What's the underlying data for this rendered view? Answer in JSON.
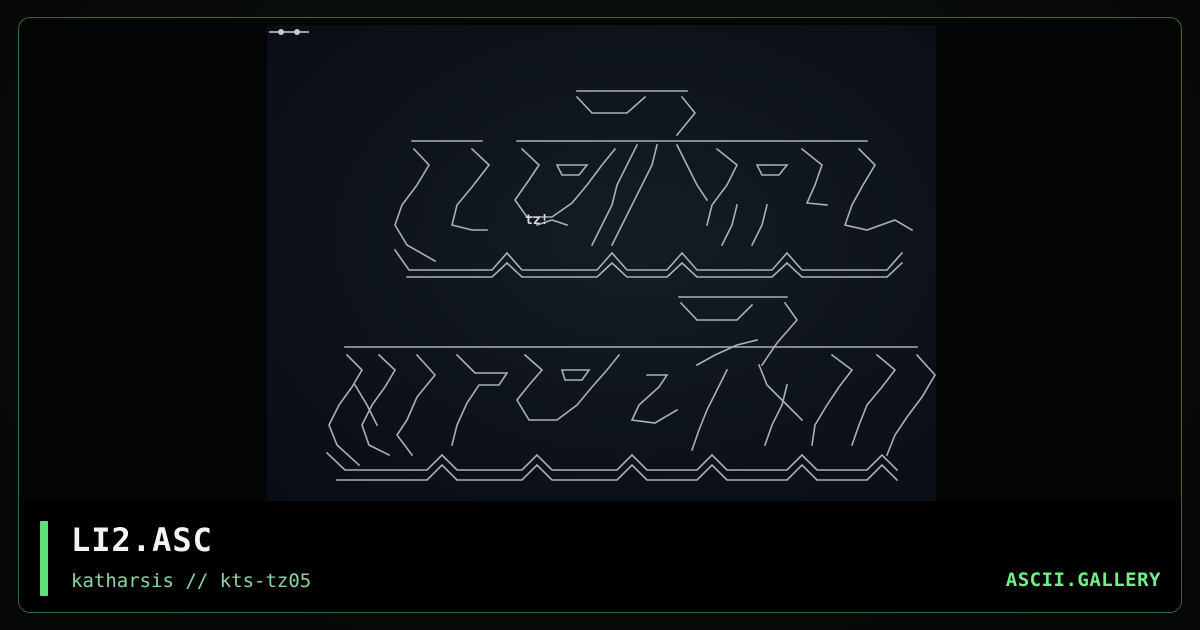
{
  "art": {
    "tag": "tz!",
    "icon": "window-controls-icon"
  },
  "info": {
    "title": "LI2.ASC",
    "subtitle": "katharsis // kts-tz05",
    "brand": "ASCII.GALLERY"
  },
  "colors": {
    "accent": "#5ee07a",
    "brand": "#6ff08a",
    "subtitle": "#8fd3a0",
    "frame_border": "#2c6b3a"
  }
}
